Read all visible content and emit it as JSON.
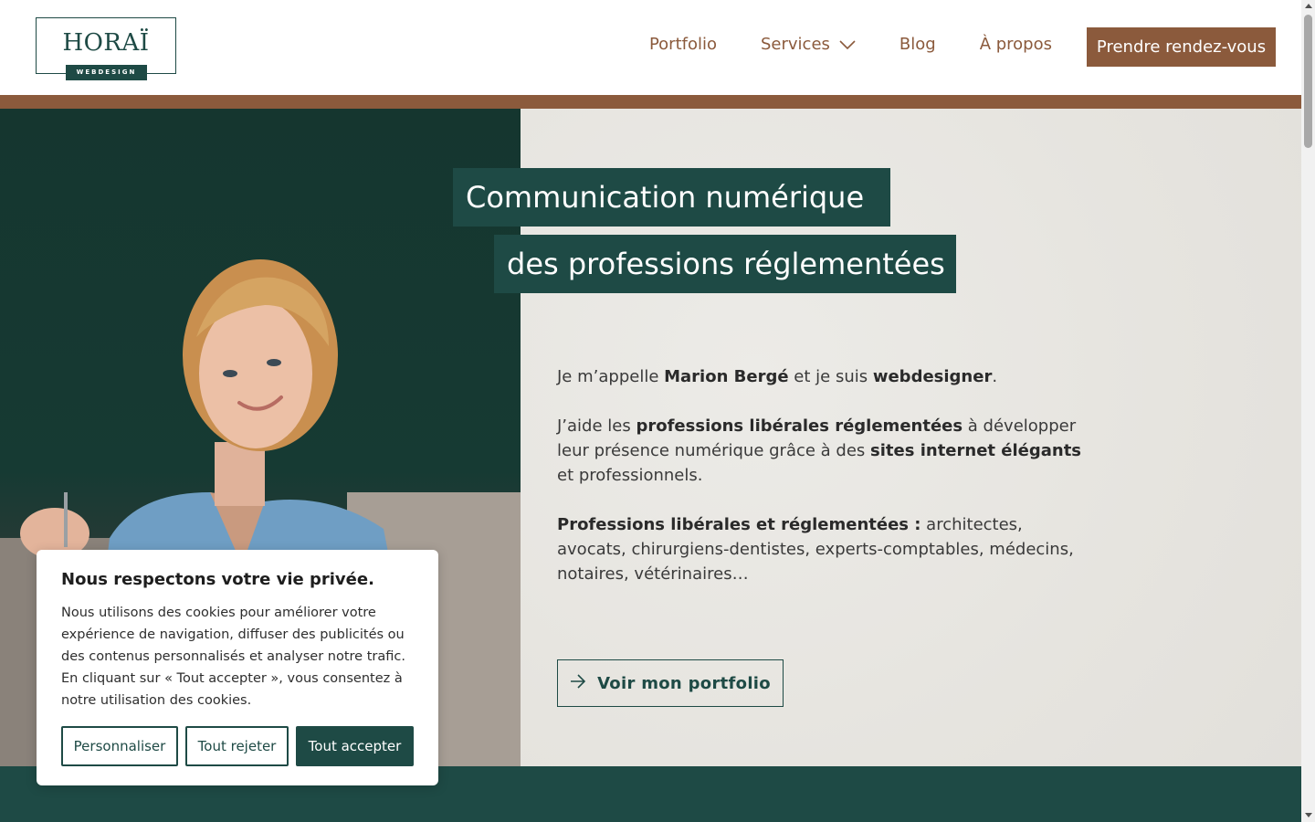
{
  "header": {
    "logo": {
      "word": "HORAÏ",
      "tag": "WEBDESIGN"
    },
    "nav": [
      {
        "label": "Portfolio"
      },
      {
        "label": "Services"
      },
      {
        "label": "Blog"
      },
      {
        "label": "À propos"
      }
    ],
    "cta_label": "Prendre rendez-vous"
  },
  "hero": {
    "title_line1": "Communication numérique",
    "title_line2": "des professions réglementées",
    "intro": {
      "t1": "Je m’appelle ",
      "b1": "Marion Bergé",
      "t2": " et je suis ",
      "b2": "webdesigner",
      "t3": "."
    },
    "help": {
      "t1": "J’aide les ",
      "b1": "professions libérales réglementées",
      "t2": " à développer leur présence numérique grâce à des ",
      "b2": "sites internet élégants",
      "t3": " et professionnels."
    },
    "professions": {
      "b1": "Professions libérales et réglementées :",
      "t1": " architectes, avocats, chirurgiens-dentistes, experts-comptables, médecins, notaires, vétérinaires…"
    },
    "portfolio_button": "Voir mon portfolio"
  },
  "cookie_banner": {
    "title": "Nous respectons votre vie privée.",
    "text": "Nous utilisons des cookies pour améliorer votre expérience de navigation, diffuser des publicités ou des contenus personnalisés et analyser notre trafic. En cliquant sur « Tout accepter », vous consentez à notre utilisation des cookies.",
    "buttons": {
      "customize": "Personnaliser",
      "reject": "Tout rejeter",
      "accept": "Tout accepter"
    }
  },
  "colors": {
    "brand_green": "#1e4a45",
    "brand_brown": "#8b5a3c",
    "background_stone": "#e6e4df"
  },
  "icons": [
    "chevron-down-icon",
    "arrow-right-icon"
  ]
}
